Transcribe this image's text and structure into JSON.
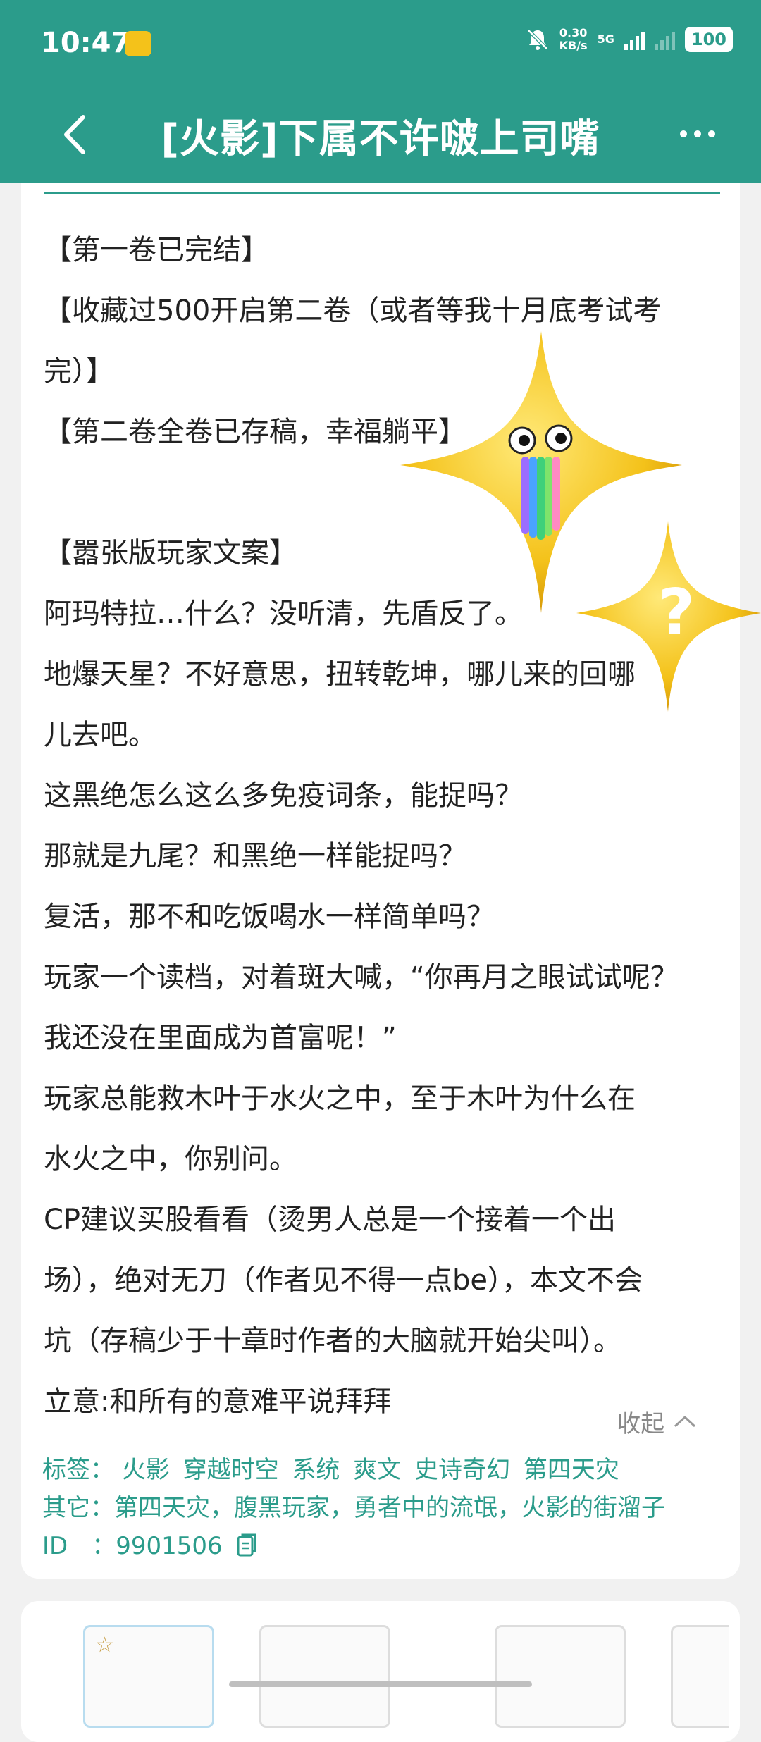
{
  "status_bar": {
    "time": "10:47",
    "net_speed_value": "0.30",
    "net_speed_unit": "KB/s",
    "network_type": "5G",
    "battery": "100"
  },
  "app_bar": {
    "title": "[火影]下属不许啵上司嘴"
  },
  "content": {
    "lines": [
      "【第一卷已完结】",
      "【收藏过500开启第二卷（或者等我十月底考试考",
      "完）】",
      "【第二卷全卷已存稿，幸福躺平】",
      "",
      "【嚣张版玩家文案】",
      "阿玛特拉…什么？没听清，先盾反了。",
      "地爆天星？不好意思，扭转乾坤，哪儿来的回哪",
      "儿去吧。",
      "这黑绝怎么这么多免疫词条，能捉吗？",
      "那就是九尾？和黑绝一样能捉吗？",
      "复活，那不和吃饭喝水一样简单吗？",
      "玩家一个读档，对着斑大喊，“你再月之眼试试呢？",
      "我还没在里面成为首富呢！”",
      "玩家总能救木叶于水火之中，至于木叶为什么在",
      "水火之中，你别问。",
      "CP建议买股看看（烫男人总是一个接着一个出",
      "场），绝对无刀（作者见不得一点be），本文不会",
      "坑（存稿少于十章时作者的大脑就开始尖叫）。",
      "立意:和所有的意难平说拜拜"
    ]
  },
  "collapse_label": "收起",
  "meta": {
    "tags_label": "标签：",
    "tags": [
      "火影",
      "穿越时空",
      "系统",
      "爽文",
      "史诗奇幻",
      "第四天灾"
    ],
    "other_label": "其它：",
    "other_value": "第四天灾，腹黑玩家，勇者中的流氓，火影的街溜子",
    "id_label": "ID　：",
    "id_value": "9901506"
  },
  "colors": {
    "accent": "#2b9c8b",
    "text": "#222222",
    "muted": "#888888"
  },
  "icons": [
    "back-icon",
    "more-icon",
    "copy-icon",
    "mute-icon",
    "chevron-up-icon",
    "star-sticker-icon"
  ]
}
